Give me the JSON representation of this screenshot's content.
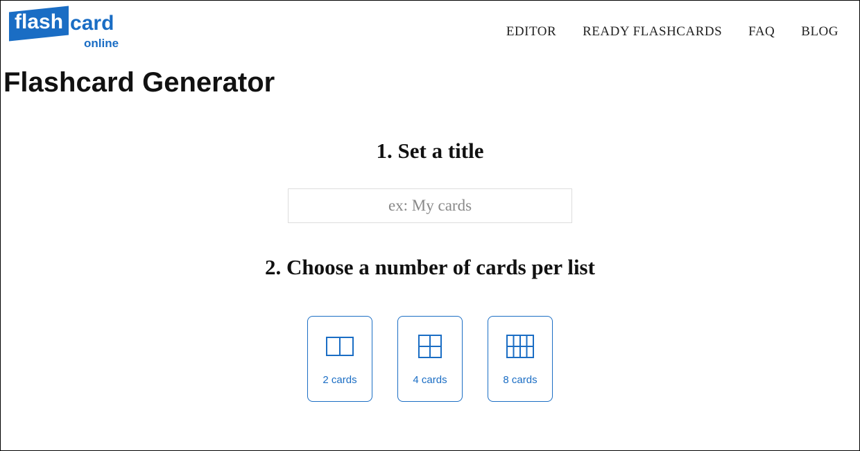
{
  "logo": {
    "flash": "flash",
    "card": "card",
    "online": "online"
  },
  "nav": {
    "editor": "EDITOR",
    "ready": "READY FLASHCARDS",
    "faq": "FAQ",
    "blog": "BLOG"
  },
  "page_title": "Flashcard Generator",
  "step1": {
    "heading": "1. Set a title",
    "placeholder": "ex: My cards"
  },
  "step2": {
    "heading": "2. Choose a number of cards per list",
    "options": [
      {
        "label": "2 cards"
      },
      {
        "label": "4 cards"
      },
      {
        "label": "8 cards"
      }
    ]
  }
}
